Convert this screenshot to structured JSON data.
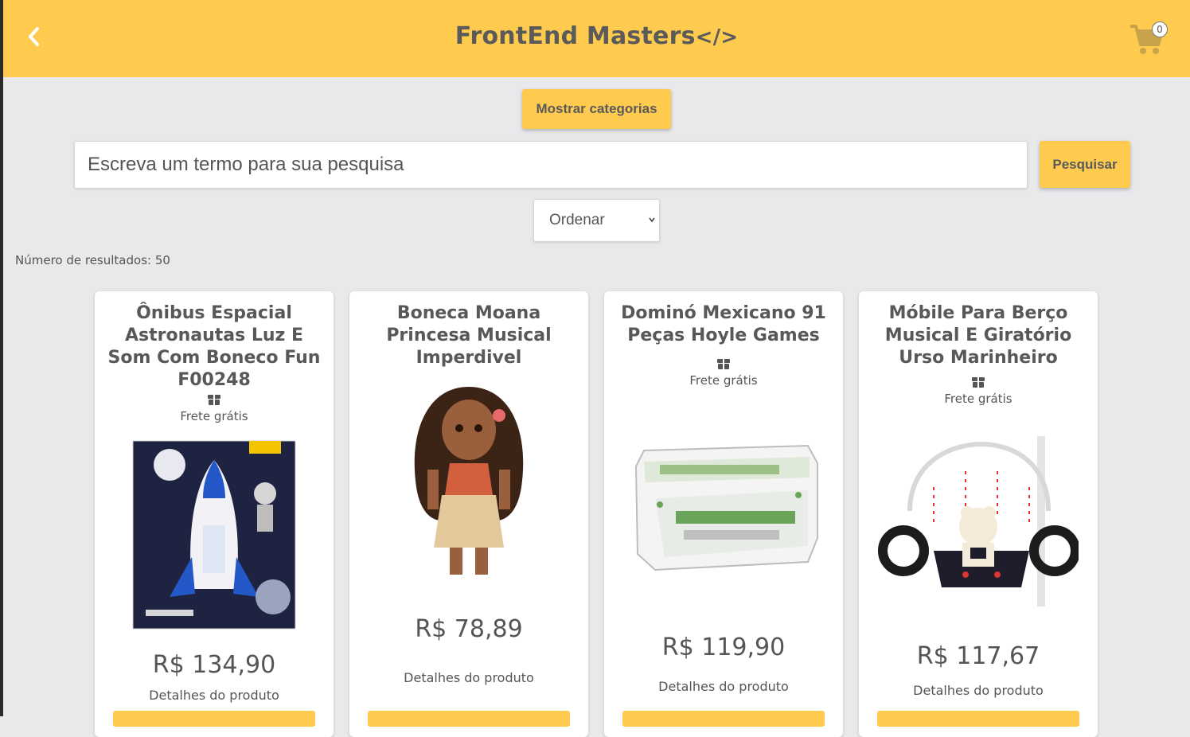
{
  "header": {
    "brand": "FrontEnd Masters",
    "brand_code": "</>",
    "cart_count": "0",
    "accent_color": "#ffcb4e"
  },
  "controls": {
    "categories_button": "Mostrar categorias",
    "search_placeholder": "Escreva um termo para sua pesquisa",
    "search_button": "Pesquisar",
    "sort_label": "Ordenar"
  },
  "results_label": "Número de resultados: 50",
  "products": [
    {
      "title": "Ônibus Espacial Astronautas Luz E Som Com Boneco Fun F00248",
      "shipping": "Frete grátis",
      "price": "R$ 134,90",
      "details": "Detalhes do produto"
    },
    {
      "title": "Boneca Moana Princesa Musical Imperdivel",
      "shipping": "",
      "price": "R$ 78,89",
      "details": "Detalhes do produto"
    },
    {
      "title": "Dominó Mexicano 91 Peças Hoyle Games",
      "shipping": "Frete grátis",
      "price": "R$ 119,90",
      "details": "Detalhes do produto"
    },
    {
      "title": "Móbile Para Berço Musical E Giratório Urso Marinheiro",
      "shipping": "Frete grátis",
      "price": "R$ 117,67",
      "details": "Detalhes do produto"
    }
  ]
}
